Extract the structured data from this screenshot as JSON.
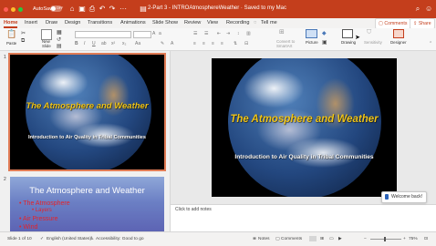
{
  "titlebar": {
    "autosave_label": "AutoSave",
    "autosave_state": "OFF",
    "doc_title": "2-Part 3 - INTROAtmosphereWeather  ·  Saved to my Mac",
    "color": "#c43e1c"
  },
  "tabs": [
    "Home",
    "Insert",
    "Draw",
    "Design",
    "Transitions",
    "Animations",
    "Slide Show",
    "Review",
    "View",
    "Recording",
    "Tell me"
  ],
  "active_tab": "Home",
  "header_buttons": {
    "comments": "Comments",
    "share": "Share"
  },
  "ribbon": {
    "paste": "Paste",
    "new_slide": "New\nSlide",
    "convert_smartart": "Convert to\nSmartArt",
    "picture": "Picture",
    "drawing": "Drawing",
    "sensitivity": "Sensitivity",
    "designer": "Designer"
  },
  "slides": [
    {
      "number": "1",
      "title": "The Atmosphere and Weather",
      "subtitle": "Introduction to Air Quality in Tribal Communities"
    },
    {
      "number": "2",
      "title": "The Atmosphere and Weather",
      "bullets": [
        "The Atmosphere",
        "Layers",
        "Air Pressure",
        "Wind"
      ]
    }
  ],
  "main_slide": {
    "title": "The Atmosphere and Weather",
    "subtitle": "Introduction to Air Quality in Tribal Communities"
  },
  "notes_placeholder": "Click to add notes",
  "welcome_toast": "Welcome back!",
  "statusbar": {
    "slide_info": "Slide 1 of 10",
    "language": "English (United States)",
    "accessibility": "Accessibility: Good to go",
    "notes": "Notes",
    "comments": "Comments",
    "zoom": "75%"
  }
}
